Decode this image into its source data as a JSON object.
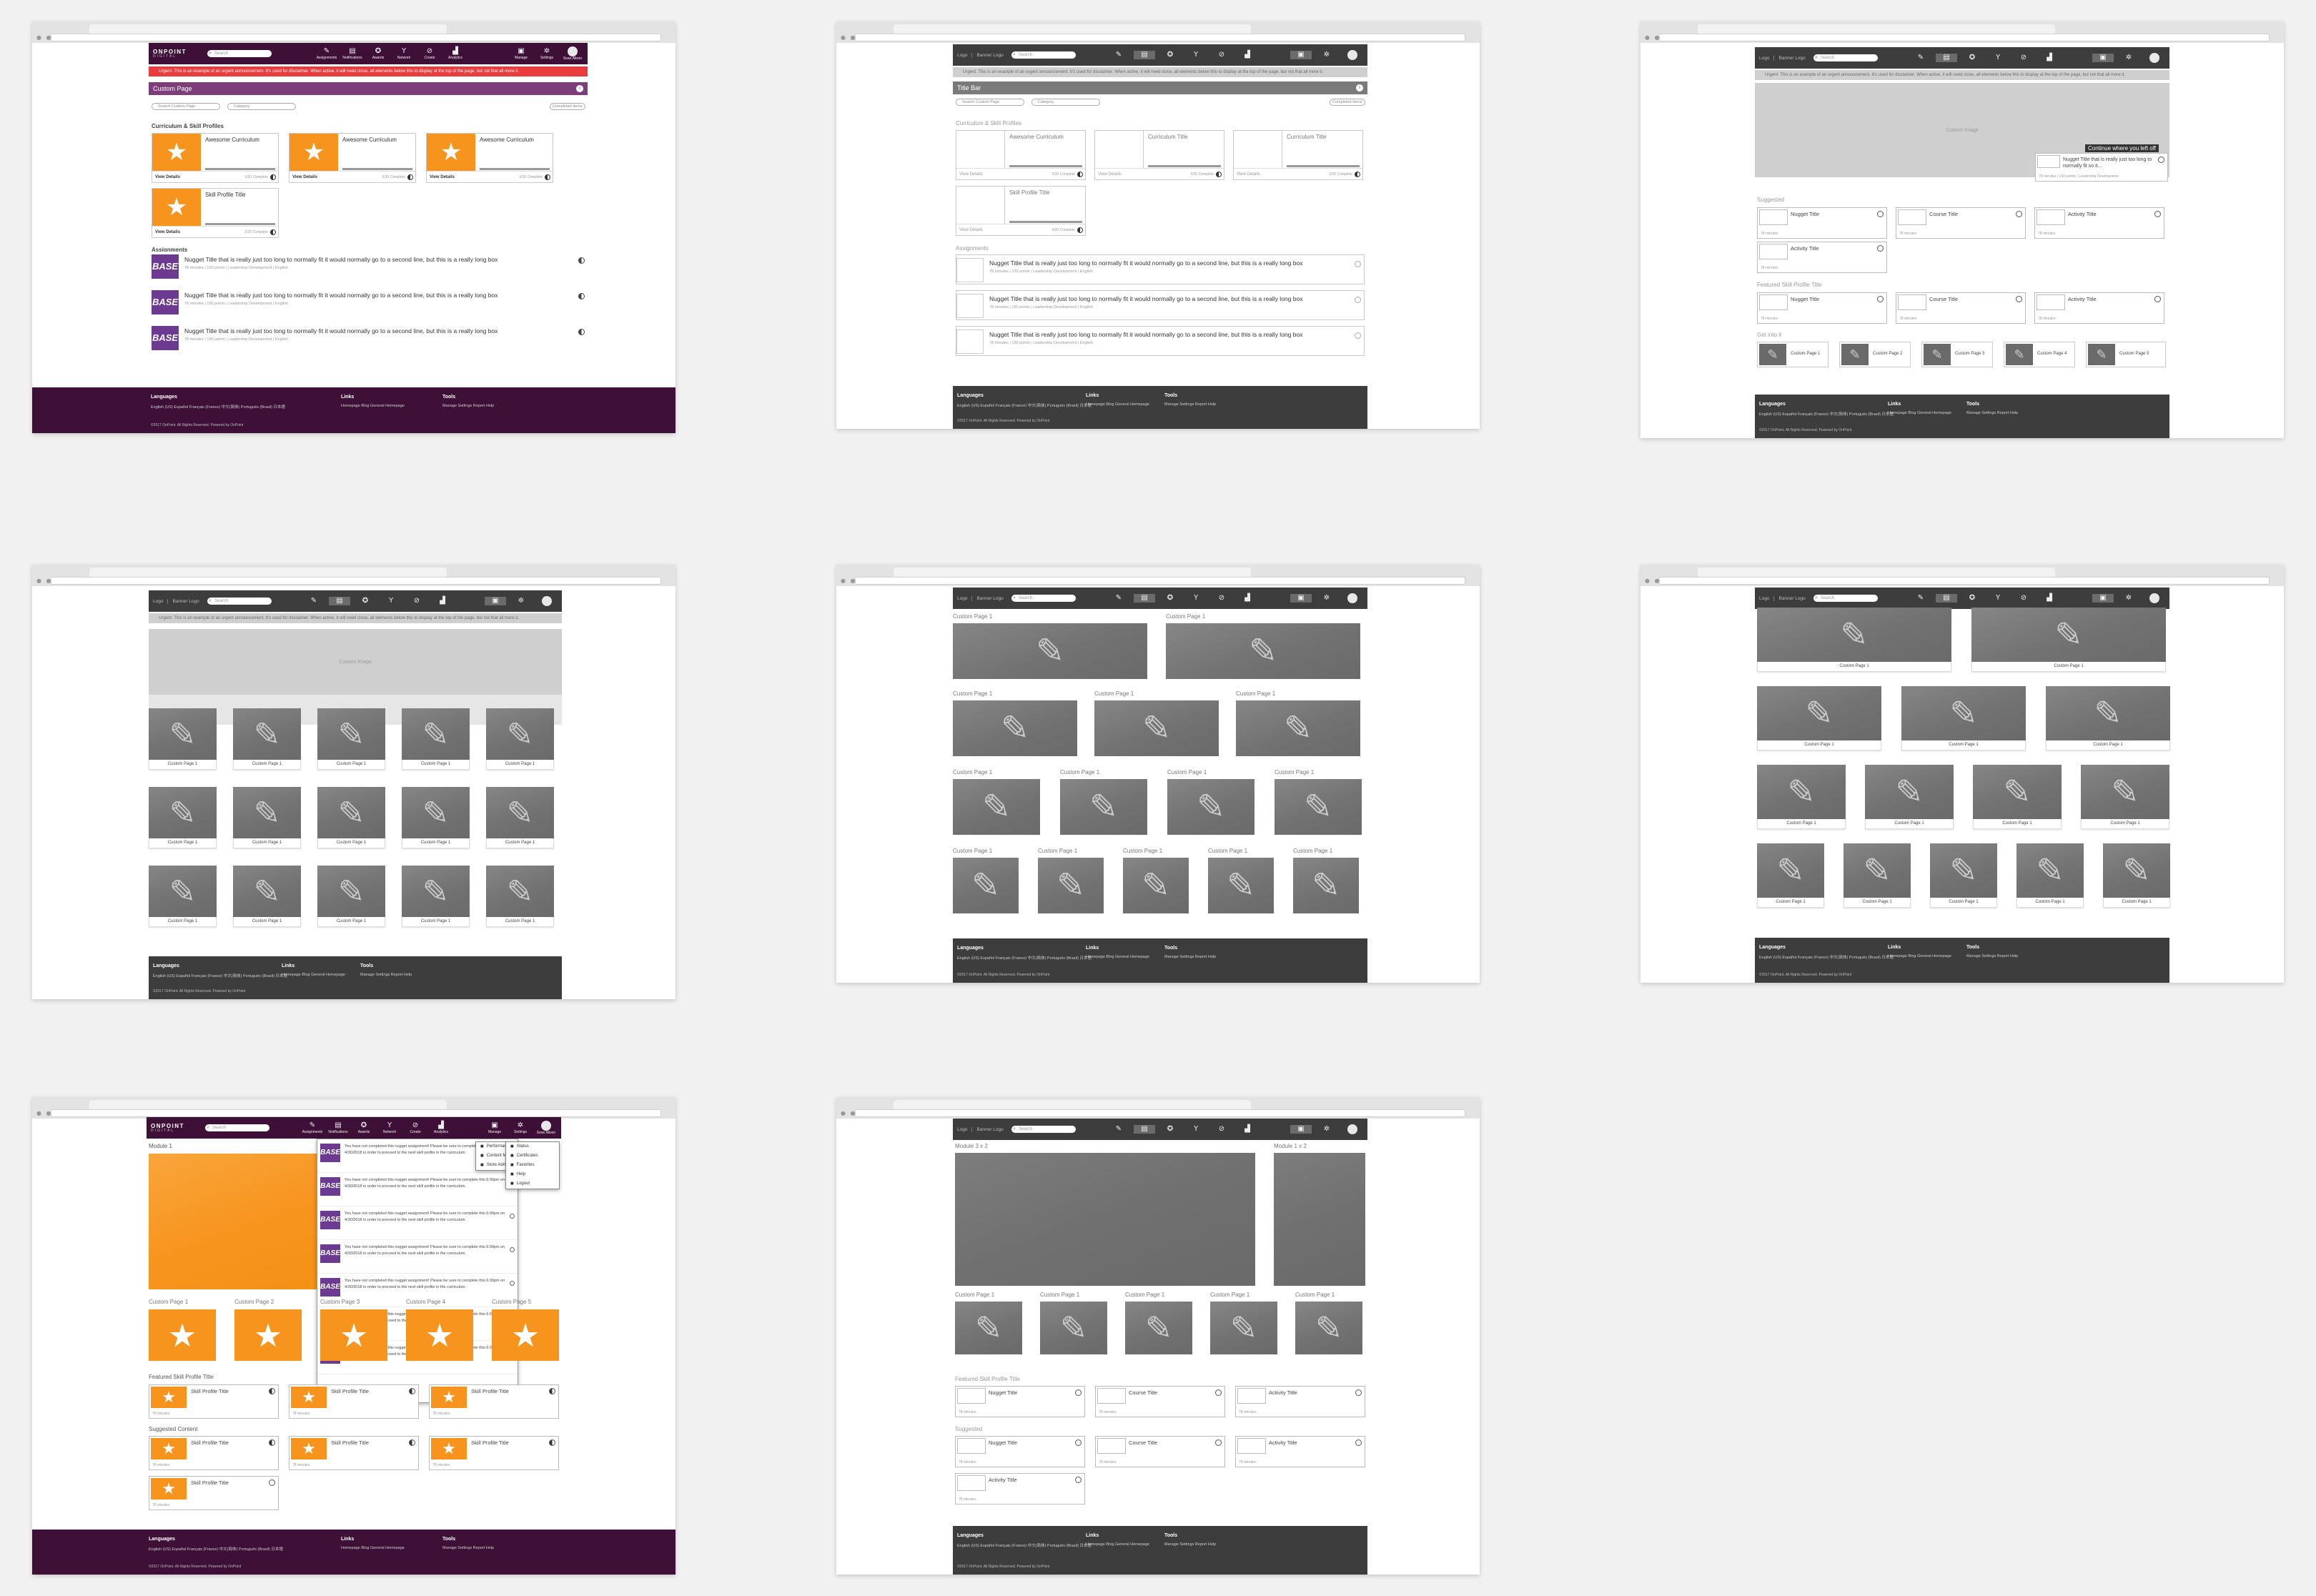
{
  "common": {
    "brand_top": "ONPOINT",
    "brand_bottom": "DIGITAL",
    "logo": "Logo",
    "banner_logo": "Banner Logo",
    "search_placeholder": "Search",
    "nav_items": [
      "Assignments",
      "Notifications",
      "Awards",
      "Network",
      "Create",
      "Analytics"
    ],
    "nav_right": [
      "Manage",
      "Settings",
      "Sean Alison"
    ],
    "alert": "Urgent: This is an example of an urgent announcement. It's used for disclaimer. When active, it will need close, all elements below this to display at the top of the page, but not that all more it.",
    "footer": {
      "languages_title": "Languages",
      "languages": "English (US)   Español   Français (France)   中文(简体)   Português (Brasil)   日本語",
      "links_title": "Links",
      "links": "Homepage   Blog   General   Homepage",
      "tools_title": "Tools",
      "tools": "Manage   Settings   Report   Help",
      "copyright": "©2017 OnPoint. All Rights Reserved. Powered by OnPoint"
    }
  },
  "screen1": {
    "title_bar": "Custom Page",
    "filter_search": "Search Custom Page",
    "filter_category": "Category",
    "filter_completed": "Completed Items",
    "section_curriculum": "Curriculum & Skill Profiles",
    "curriculum_cards": [
      "Awesome Curriculum",
      "Awesome Curriculum",
      "Awesome Curriculum",
      "Skill Profile Title"
    ],
    "view_details": "View Details",
    "complete_text": "0/20 Complete",
    "section_assignments": "Assignments",
    "badge": "BASE",
    "assignment_title": "Nugget Title that is really just too long to normally fit it would normally go to a second line, but this is a really long box",
    "assignment_meta": "78 minutes  |  150 points  |  Leadership Development  |  English"
  },
  "screen2": {
    "title_bar": "Title Bar",
    "filter_search": "Search Custom Page",
    "filter_category": "Category",
    "filter_completed": "Completed Items",
    "section_curriculum": "Curriculum & Skill Profiles",
    "curriculum_cards": [
      "Awesome Curriculum",
      "Curriculum Title",
      "Curriculum Title",
      "Skill Profile Title"
    ],
    "view_details": "View Details",
    "complete_text": "0/20 Complete",
    "section_assignments": "Assignments",
    "assignment_title": "Nugget Title that is really just too long to normally fit it would normally go to a second line, but this is a really long box",
    "assignment_meta": "78 minutes  |  150 points  |  Leadership Development  |  English"
  },
  "screen3": {
    "hero_label": "Custom Image",
    "continue_label": "Continue where you left off",
    "continue_card_title": "Nugget Title that is really just too long to normally fit so it...",
    "continue_card_meta": "78 minutes  |  150 points  |  Leadership Development",
    "section_suggested": "Suggested",
    "suggested": [
      "Nugget Title",
      "Course Title",
      "Activity Title",
      "Activity Title"
    ],
    "section_featured": "Featured Skill Profile Title",
    "featured": [
      "Nugget Title",
      "Course Title",
      "Activity Title"
    ],
    "minutes": "78 minutes",
    "section_getinto": "Get into it",
    "get_into": [
      "Custom Page 1",
      "Custom Page 2",
      "Custom Page 3",
      "Custom Page 4",
      "Custom Page 5"
    ]
  },
  "screen4": {
    "hero_label": "Custom Image",
    "tile_label": "Custom Page 1"
  },
  "screen5": {
    "tile_label": "Custom Page 1"
  },
  "screen6": {
    "tile_label": "Custom Page 1"
  },
  "screen7": {
    "module": "Module 1",
    "pages": [
      "Custom Page 1",
      "Custom Page 2",
      "Custom Page 3",
      "Custom Page 4",
      "Custom Page 5"
    ],
    "section_featured": "Featured Skill Profile Title",
    "section_suggested": "Suggested Content",
    "skill_title": "Skill Profile Title",
    "minutes": "78 minutes",
    "notification_text": "You have not completed this nugget assignment! Please be sure to complete this 6:00pm on 4/30/2018 in order to proceed to the next skill profile in the curriculum.",
    "submenu": [
      "Performance",
      "Content Manager",
      "Store Admin"
    ],
    "account_menu": [
      "Status",
      "Certificates",
      "Favorites",
      "Help",
      "Logout"
    ]
  },
  "screen8": {
    "module_big": "Module 3 x 2",
    "module_small": "Module 1 x 2",
    "tile_label": "Custom Page 1",
    "section_featured": "Featured Skill Profile Title",
    "featured": [
      "Nugget Title",
      "Course Title",
      "Activity Title"
    ],
    "section_suggested": "Suggested",
    "suggested": [
      "Nugget Title",
      "Course Title",
      "Activity Title",
      "Activity Title"
    ],
    "minutes": "78 minutes"
  },
  "icons": {
    "pencil": "pencil-icon",
    "star": "star-icon",
    "search": "search-icon",
    "info": "info-icon",
    "progress": "progress-indicator-icon"
  },
  "colors": {
    "brand_purple": "#3e1038",
    "title_purple": "#7d3d7a",
    "alert_red": "#ea3c3c",
    "accent_orange": "#f7941d",
    "badge_purple": "#6c3a91",
    "wireframe_gray": "#3d3d3d"
  }
}
